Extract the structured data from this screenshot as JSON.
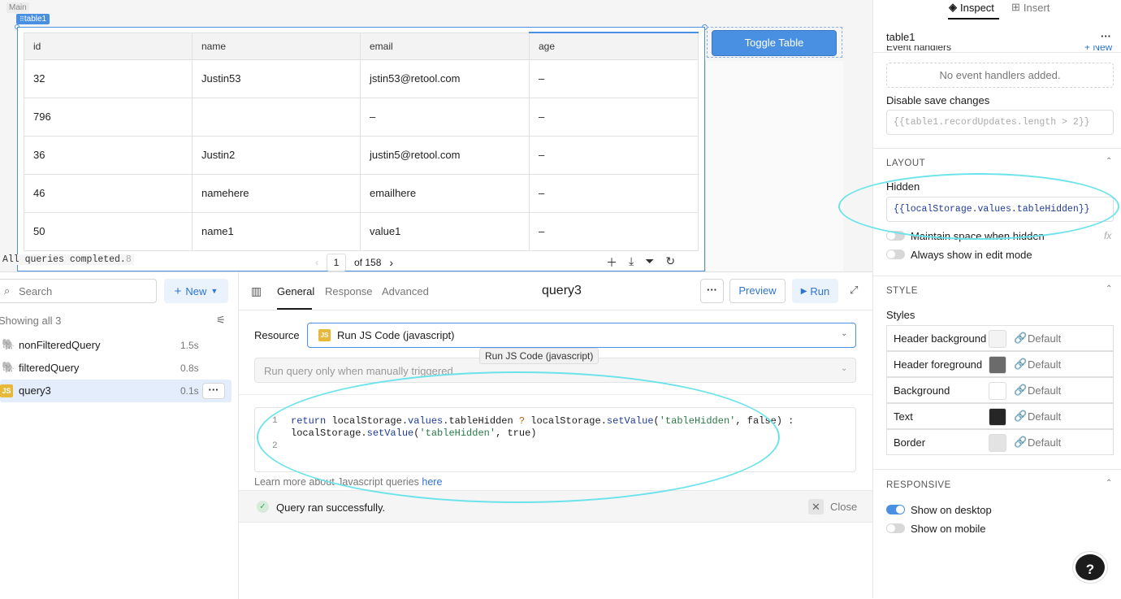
{
  "canvas": {
    "main_label": "Main",
    "table_tag": "table1",
    "columns": [
      "id",
      "name",
      "email",
      "age"
    ],
    "rows": [
      [
        "32",
        "Justin53",
        "jstin53@retool.com",
        "–"
      ],
      [
        "796",
        "",
        "–",
        "–"
      ],
      [
        "36",
        "Justin2",
        "justin5@retool.com",
        "–"
      ],
      [
        "46",
        "namehere",
        "emailhere",
        "–"
      ],
      [
        "50",
        "name1",
        "value1",
        "–"
      ]
    ],
    "pager_current": "1",
    "pager_total": "of 158",
    "status_line": "All queries completed.",
    "status_overlap_digit": "8",
    "toggle_button": "Toggle Table"
  },
  "queries": {
    "search_placeholder": "Search",
    "new_label": "New",
    "showing": "Showing all 3",
    "items": [
      {
        "name": "nonFilteredQuery",
        "time": "1.5s",
        "icon": "database-icon"
      },
      {
        "name": "filteredQuery",
        "time": "0.8s",
        "icon": "database-icon"
      },
      {
        "name": "query3",
        "time": "0.1s",
        "icon": "js-icon",
        "badge": "JS"
      }
    ]
  },
  "editor": {
    "tabs": [
      "General",
      "Response",
      "Advanced"
    ],
    "title": "query3",
    "preview_label": "Preview",
    "run_label": "Run",
    "resource_label": "Resource",
    "resource_badge": "JS",
    "resource_value": "Run JS Code (javascript)",
    "tooltip": "Run JS Code (javascript)",
    "trigger_value": "Run query only when manually triggered",
    "line_numbers": [
      "1",
      "2"
    ],
    "code": {
      "t1": "return",
      "t2": " localStorage.",
      "t3": "values",
      "t4": ".tableHidden ",
      "t5": "?",
      "t6": " localStorage.",
      "t7": "setValue",
      "t8": "(",
      "t9": "'tableHidden'",
      "t10": ", false) :",
      "t11": "localStorage.",
      "t12": "setValue",
      "t13": "(",
      "t14": "'tableHidden'",
      "t15": ", true)"
    },
    "learn_more": "Learn more about Javascript queries ",
    "learn_link": "here",
    "success_text": "Query ran successfully.",
    "close_label": "Close"
  },
  "inspector": {
    "tabs": [
      "Inspect",
      "Insert"
    ],
    "component_name": "table1",
    "event_handlers_label": "Event handlers",
    "new_link": "+ New",
    "no_handlers": "No event handlers added.",
    "disable_save_label": "Disable save changes",
    "disable_save_value": "{{table1.recordUpdates.length > 2}}",
    "layout_title": "LAYOUT",
    "hidden_label": "Hidden",
    "hidden_value": "{{localStorage.values.tableHidden}}",
    "maintain_space": "Maintain space when hidden",
    "always_show": "Always show in edit mode",
    "fx": "fx",
    "style_title": "STYLE",
    "styles_label": "Styles",
    "style_rows": [
      {
        "label": "Header background",
        "color": "#f3f3f3",
        "value": "Default"
      },
      {
        "label": "Header foreground",
        "color": "#6b6b6b",
        "value": "Default"
      },
      {
        "label": "Background",
        "color": "#ffffff",
        "value": "Default"
      },
      {
        "label": "Text",
        "color": "#262626",
        "value": "Default"
      },
      {
        "label": "Border",
        "color": "#e3e3e3",
        "value": "Default"
      }
    ],
    "responsive_title": "RESPONSIVE",
    "show_desktop": "Show on desktop",
    "show_mobile": "Show on mobile",
    "toggles": {
      "maintain_space": false,
      "always_show": false,
      "desktop": true,
      "mobile": false
    }
  },
  "colors": {
    "accent": "#4a90e2",
    "annotation": "#6be3ea",
    "success": "#3aa55d"
  }
}
